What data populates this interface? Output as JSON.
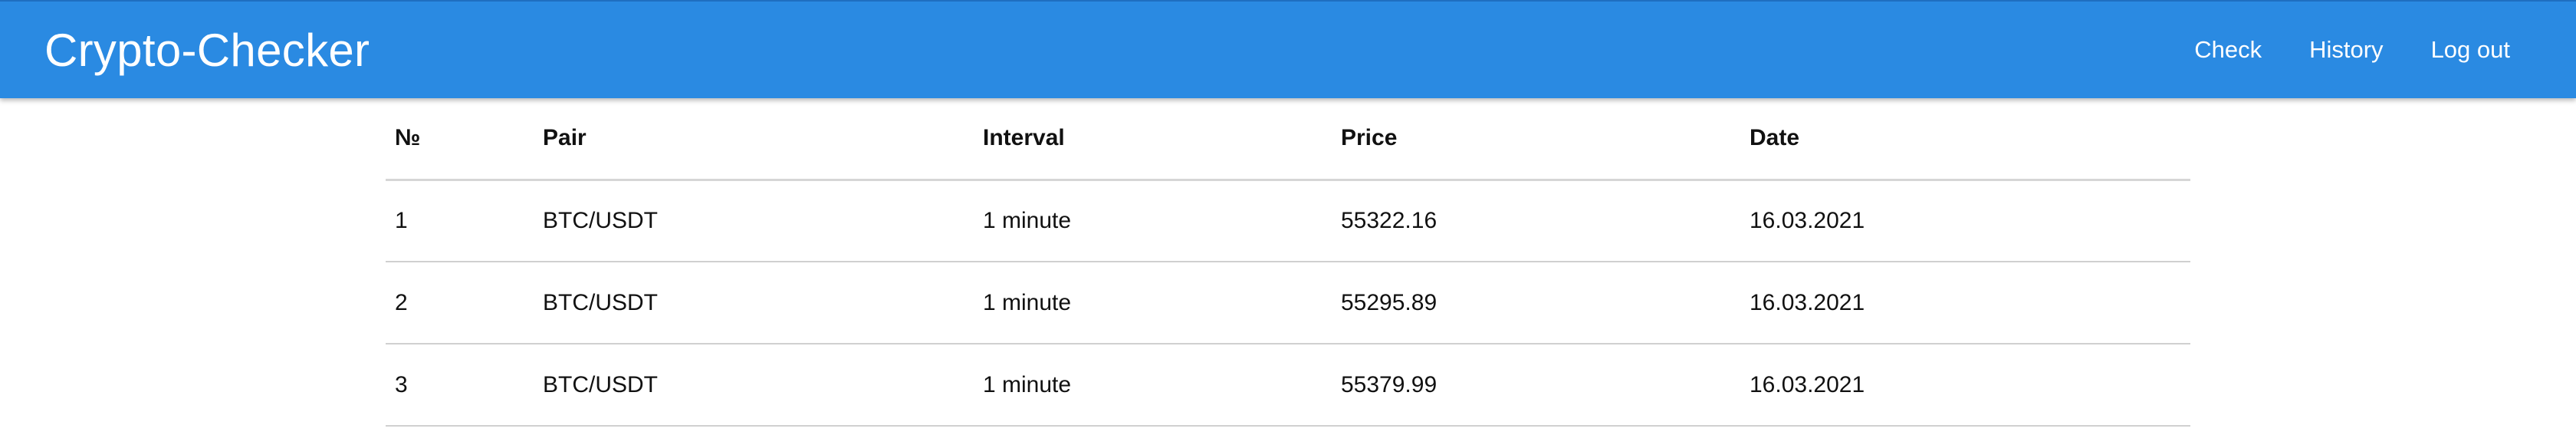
{
  "navbar": {
    "brand": "Crypto-Checker",
    "links": [
      "Check",
      "History",
      "Log out"
    ],
    "background": "#2a8ae2"
  },
  "table": {
    "headers": [
      "№",
      "Pair",
      "Interval",
      "Price",
      "Date"
    ],
    "rows": [
      [
        "1",
        "BTC/USDT",
        "1 minute",
        "55322.16",
        "16.03.2021"
      ],
      [
        "2",
        "BTC/USDT",
        "1 minute",
        "55295.89",
        "16.03.2021"
      ],
      [
        "3",
        "BTC/USDT",
        "1 minute",
        "55379.99",
        "16.03.2021"
      ]
    ]
  }
}
